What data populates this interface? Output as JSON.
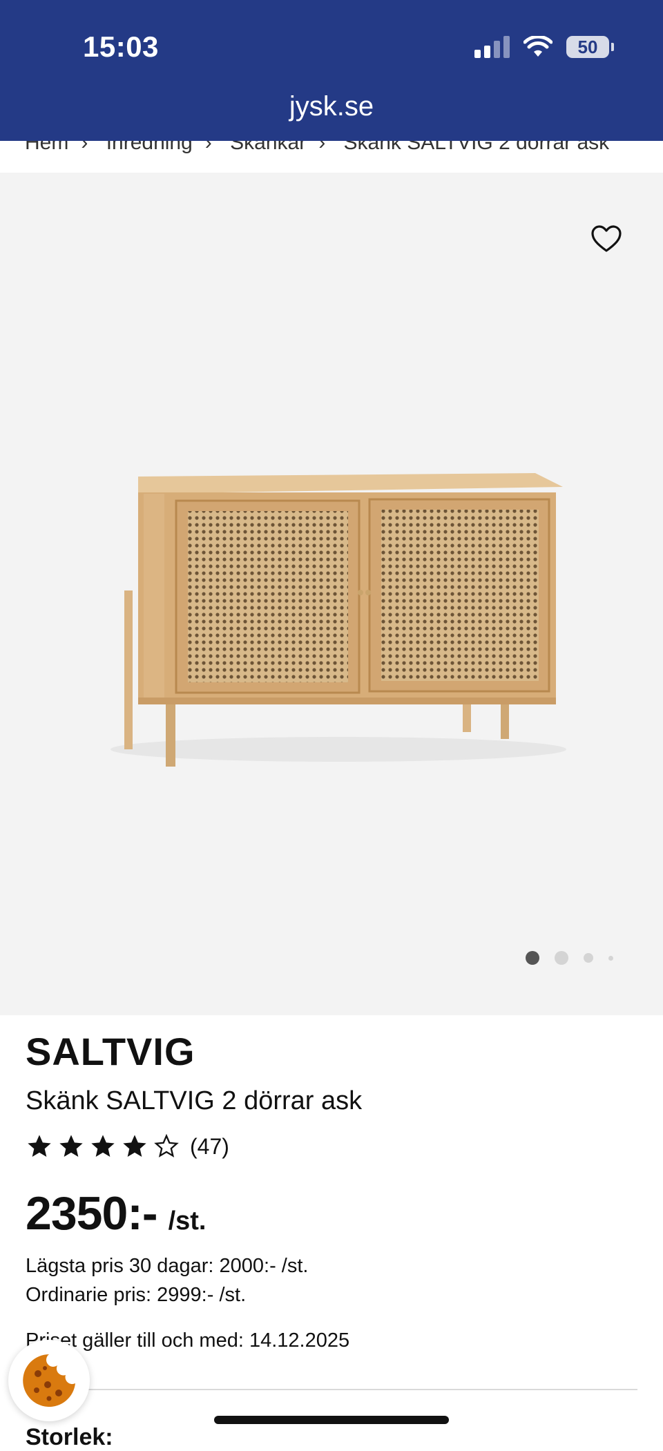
{
  "status_bar": {
    "time": "15:03",
    "battery": "50"
  },
  "browser": {
    "url": "jysk.se"
  },
  "breadcrumb": [
    "Hem",
    "Inredning",
    "Skänkar",
    "Skänk SALTVIG 2 dörrar ask"
  ],
  "gallery": {
    "image_count": 4,
    "active_index": 0
  },
  "product": {
    "brand": "SALTVIG",
    "name": "Skänk SALTVIG 2 dörrar ask",
    "rating": 4,
    "rating_max": 5,
    "review_count": "(47)",
    "price": "2350:-",
    "price_unit": "/st.",
    "lowest_price": "Lägsta pris 30 dagar: 2000:- /st.",
    "ordinary_price": "Ordinarie pris: 2999:- /st.",
    "valid_until": "Priset gäller till och med: 14.12.2025",
    "size_label": "Storlek:"
  },
  "colors": {
    "header": "#243a86",
    "background": "#f3f3f3",
    "cookie": "#d97a0f"
  },
  "icons": {
    "favorite": "heart-icon",
    "cookie": "cookie-icon",
    "wifi": "wifi-icon",
    "signal": "signal-icon",
    "battery": "battery-icon"
  }
}
